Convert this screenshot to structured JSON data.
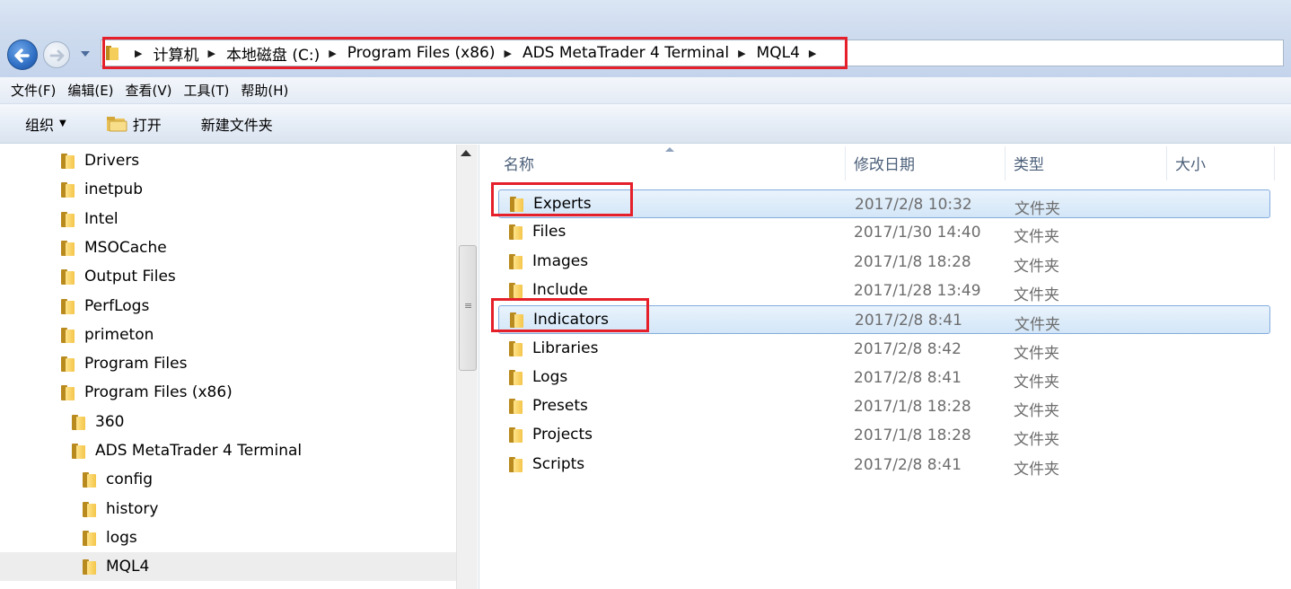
{
  "breadcrumb": [
    "计算机",
    "本地磁盘 (C:)",
    "Program Files (x86)",
    "ADS MetaTrader 4 Terminal",
    "MQL4"
  ],
  "menu": [
    "文件(F)",
    "编辑(E)",
    "查看(V)",
    "工具(T)",
    "帮助(H)"
  ],
  "toolbar": {
    "organize": "组织",
    "open": "打开",
    "new_folder": "新建文件夹"
  },
  "nav_tree": [
    {
      "label": "Drivers",
      "level": 0
    },
    {
      "label": "inetpub",
      "level": 0
    },
    {
      "label": "Intel",
      "level": 0
    },
    {
      "label": "MSOCache",
      "level": 0
    },
    {
      "label": "Output Files",
      "level": 0
    },
    {
      "label": "PerfLogs",
      "level": 0
    },
    {
      "label": "primeton",
      "level": 0
    },
    {
      "label": "Program Files",
      "level": 0
    },
    {
      "label": "Program Files (x86)",
      "level": 0
    },
    {
      "label": "360",
      "level": 1
    },
    {
      "label": "ADS MetaTrader 4 Terminal",
      "level": 1
    },
    {
      "label": "config",
      "level": 2
    },
    {
      "label": "history",
      "level": 2
    },
    {
      "label": "logs",
      "level": 2
    },
    {
      "label": "MQL4",
      "level": 2,
      "selected": true
    }
  ],
  "columns": {
    "name": "名称",
    "date": "修改日期",
    "type": "类型",
    "size": "大小"
  },
  "files": [
    {
      "name": "Experts",
      "date": "2017/2/8 10:32",
      "type": "文件夹",
      "selected": true,
      "highlighted": true
    },
    {
      "name": "Files",
      "date": "2017/1/30 14:40",
      "type": "文件夹"
    },
    {
      "name": "Images",
      "date": "2017/1/8 18:28",
      "type": "文件夹"
    },
    {
      "name": "Include",
      "date": "2017/1/28 13:49",
      "type": "文件夹"
    },
    {
      "name": "Indicators",
      "date": "2017/2/8 8:41",
      "type": "文件夹",
      "selected": true,
      "highlighted": true
    },
    {
      "name": "Libraries",
      "date": "2017/2/8 8:42",
      "type": "文件夹"
    },
    {
      "name": "Logs",
      "date": "2017/2/8 8:41",
      "type": "文件夹"
    },
    {
      "name": "Presets",
      "date": "2017/1/8 18:28",
      "type": "文件夹"
    },
    {
      "name": "Projects",
      "date": "2017/1/8 18:28",
      "type": "文件夹"
    },
    {
      "name": "Scripts",
      "date": "2017/2/8 8:41",
      "type": "文件夹"
    }
  ],
  "colors": {
    "highlight_box": "#e5202a",
    "selection_border": "#84acdd",
    "header_text": "#4c607a"
  }
}
